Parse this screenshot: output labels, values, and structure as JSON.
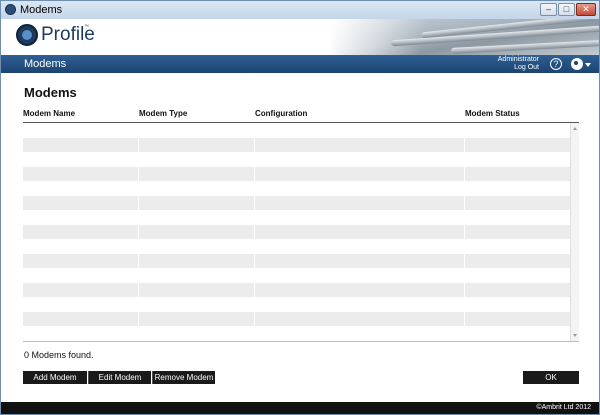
{
  "window": {
    "title": "Modems",
    "minimize_glyph": "–",
    "maximize_glyph": "□",
    "close_glyph": "✕"
  },
  "brand": {
    "logo_text": "Profile",
    "logo_tm": "™"
  },
  "nav": {
    "title": "Modems",
    "user": "Administrator",
    "logout": "Log Out",
    "help_glyph": "?"
  },
  "page": {
    "title": "Modems",
    "columns": [
      "Modem Name",
      "Modem Type",
      "Configuration",
      "Modem Status"
    ],
    "rows": [],
    "status_text": "0 Modems found."
  },
  "actions": {
    "add": "Add Modem",
    "edit": "Edit Modem",
    "remove": "Remove Modem",
    "ok": "OK"
  },
  "footer": {
    "copyright": "©Ambrit Ltd 2012"
  },
  "colors": {
    "navbar": "#1b4470",
    "button": "#1a1a1a",
    "row_alt": "#ececec"
  }
}
